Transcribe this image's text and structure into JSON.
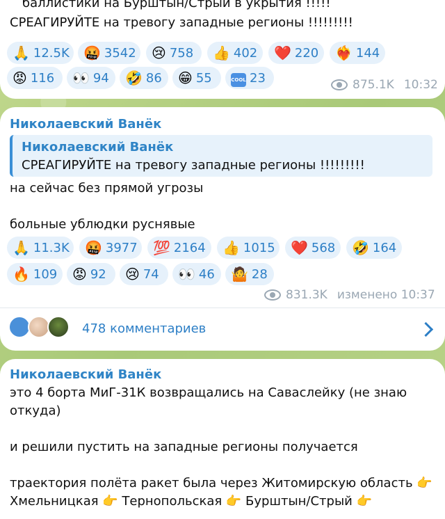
{
  "post1": {
    "line1": "баллистики на Бурштын/Стрый  в укрытия !!!!!",
    "line2": "СРЕАГИРУЙТЕ на тревогу западные регионы !!!!!!!!!",
    "reactions": [
      {
        "emoji": "🙏",
        "count": "12.5K"
      },
      {
        "emoji": "🤬",
        "count": "3542"
      },
      {
        "emoji": "😢",
        "count": "758"
      },
      {
        "emoji": "👍",
        "count": "402"
      },
      {
        "emoji": "❤️",
        "count": "220"
      },
      {
        "emoji": "❤️‍🔥",
        "count": "144"
      },
      {
        "emoji": "😡",
        "count": "116"
      },
      {
        "emoji": "👀",
        "count": "94"
      },
      {
        "emoji": "🤣",
        "count": "86"
      },
      {
        "emoji": "😁",
        "count": "55"
      },
      {
        "emoji": "🆒",
        "count": "23"
      }
    ],
    "views": "875.1K",
    "time": "10:32"
  },
  "post2": {
    "author": "Николаевский Ванёк",
    "reply_author": "Николаевский Ванёк",
    "reply_text": "СРЕАГИРУЙТЕ на тревогу западные регионы !!!!!!!!!",
    "line1": "на сейчас без прямой угрозы",
    "line2": "больные ублюдки руснявые",
    "reactions": [
      {
        "emoji": "🙏",
        "count": "11.3K"
      },
      {
        "emoji": "🤬",
        "count": "3977"
      },
      {
        "emoji": "💯",
        "count": "2164"
      },
      {
        "emoji": "👍",
        "count": "1015"
      },
      {
        "emoji": "❤️",
        "count": "568"
      },
      {
        "emoji": "🤣",
        "count": "164"
      },
      {
        "emoji": "🔥",
        "count": "109"
      },
      {
        "emoji": "😡",
        "count": "92"
      },
      {
        "emoji": "😢",
        "count": "74"
      },
      {
        "emoji": "👀",
        "count": "46"
      },
      {
        "emoji": "🤷",
        "count": "28"
      }
    ],
    "views": "831.3K",
    "edited_time": "изменено 10:37",
    "comments_label": "478 комментариев"
  },
  "post3": {
    "author": "Николаевский Ванёк",
    "line1": "это 4 борта МиГ-31К возвращались на Саваслейку (не знаю",
    "line2": "откуда)",
    "line3": "и решили пустить на западные регионы получается",
    "line4": "траектория полёта ракет была через Житомирскую область 👉",
    "line5": "Хмельницкая 👉 Тернопольская 👉 Бурштын/Стрый 👉"
  },
  "colors": {
    "accent": "#2d7fc6",
    "author": "#2f84c6",
    "reaction_bg": "#e6f1fb",
    "meta": "#9aa7b3"
  }
}
